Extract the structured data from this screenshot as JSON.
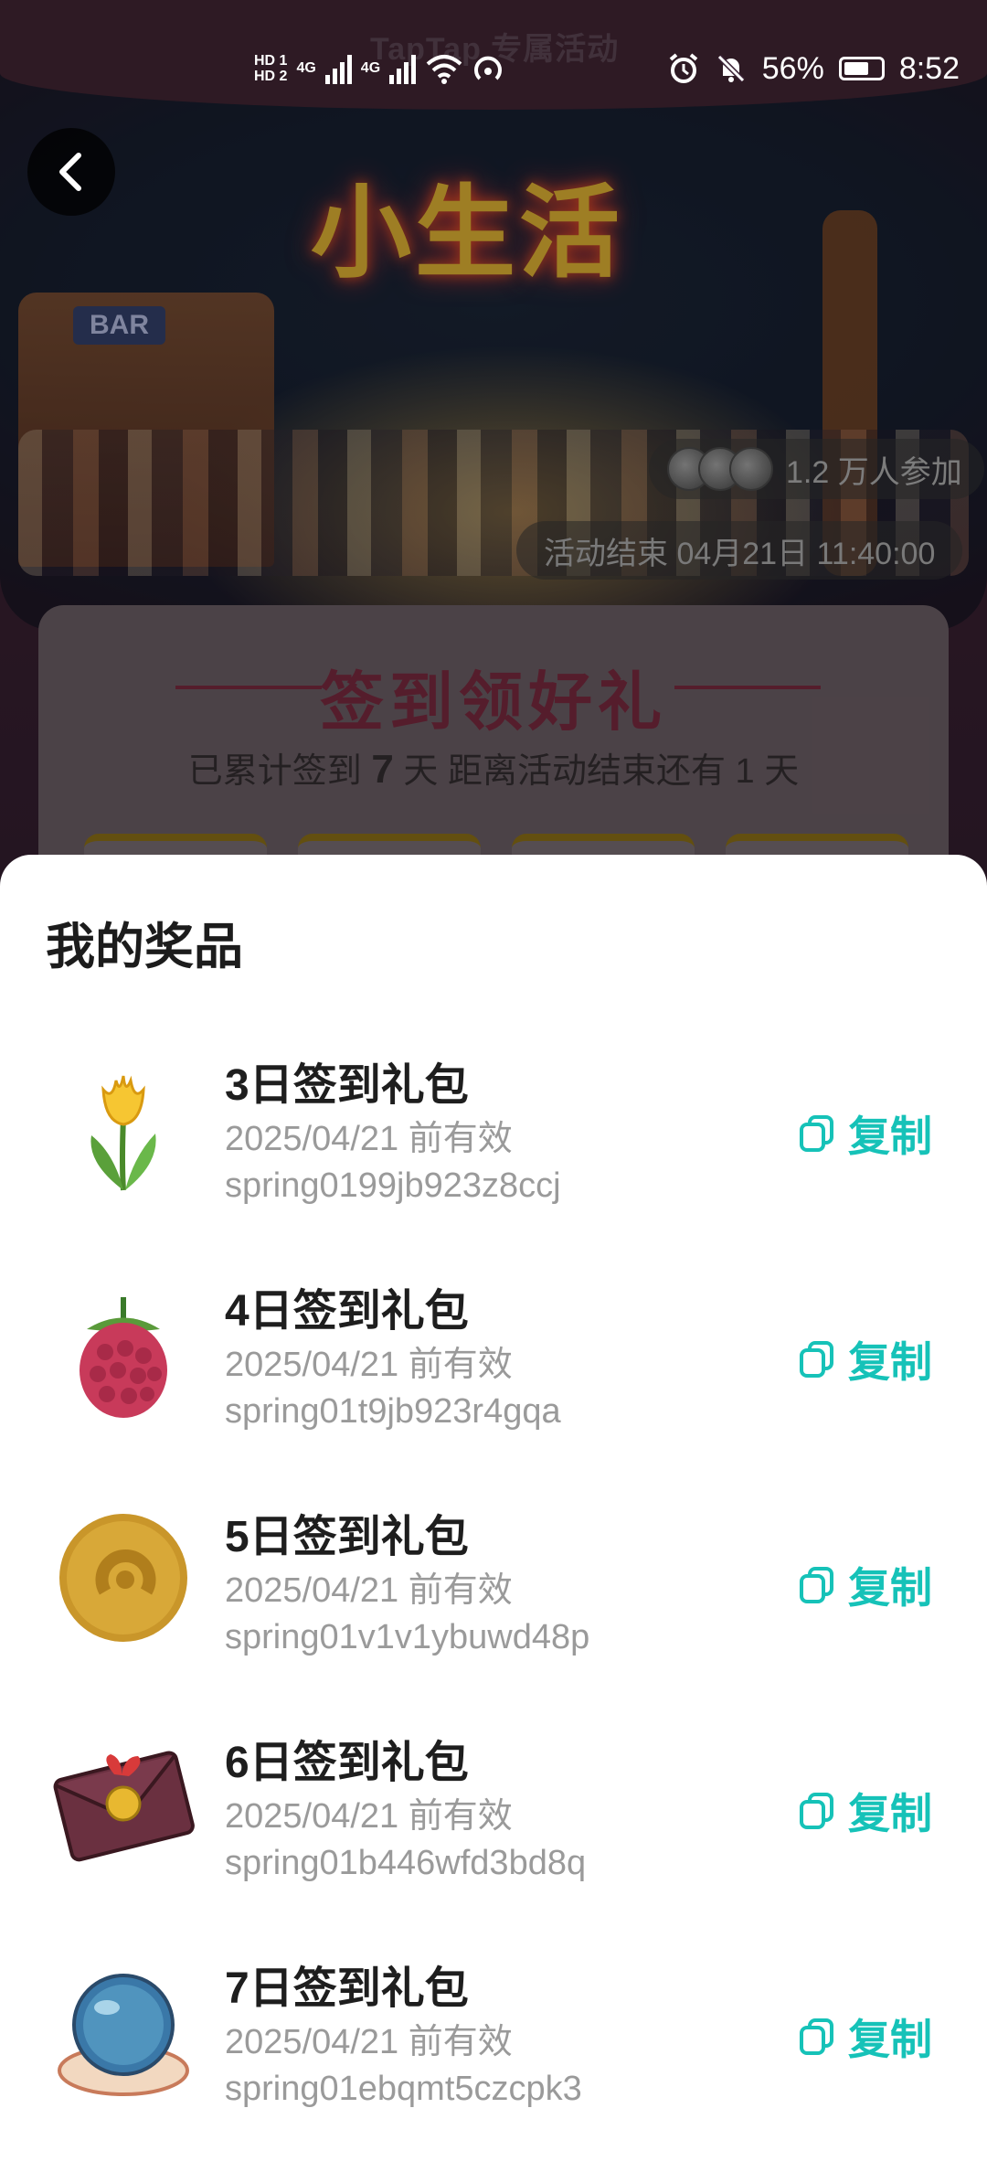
{
  "status_bar": {
    "time": "8:52",
    "battery": "56%",
    "hd1": "HD 1",
    "hd2": "HD 2",
    "net": "4G"
  },
  "banner": {
    "brand": "TapTap 专属活动",
    "title": "小生活",
    "bar_sign": "BAR",
    "participants": "1.2 万人参加",
    "end_time": "活动结束 04月21日 11:40:00"
  },
  "signin_card": {
    "title": "签到领好礼",
    "days_prefix": "已累计签到",
    "days_value": "7",
    "days_suffix": "天  距离活动结束还有 1 天"
  },
  "sheet": {
    "title": "我的奖品",
    "copy_label": "复制",
    "items": [
      {
        "name": "3日签到礼包",
        "valid": "2025/04/21 前有效",
        "code": "spring0199jb923z8ccj",
        "icon": "tulip-icon"
      },
      {
        "name": "4日签到礼包",
        "valid": "2025/04/21 前有效",
        "code": "spring01t9jb923r4gqa",
        "icon": "raspberry-icon"
      },
      {
        "name": "5日签到礼包",
        "valid": "2025/04/21 前有效",
        "code": "spring01v1v1ybuwd48p",
        "icon": "gold-coin-icon"
      },
      {
        "name": "6日签到礼包",
        "valid": "2025/04/21 前有效",
        "code": "spring01b446wfd3bd8q",
        "icon": "envelope-icon"
      },
      {
        "name": "7日签到礼包",
        "valid": "2025/04/21 前有效",
        "code": "spring01ebqmt5czcpk3",
        "icon": "crystal-ball-icon"
      }
    ]
  },
  "colors": {
    "accent": "#16c2b8",
    "title_text": "#1e1e1e",
    "secondary_text": "#9a9a9a"
  }
}
